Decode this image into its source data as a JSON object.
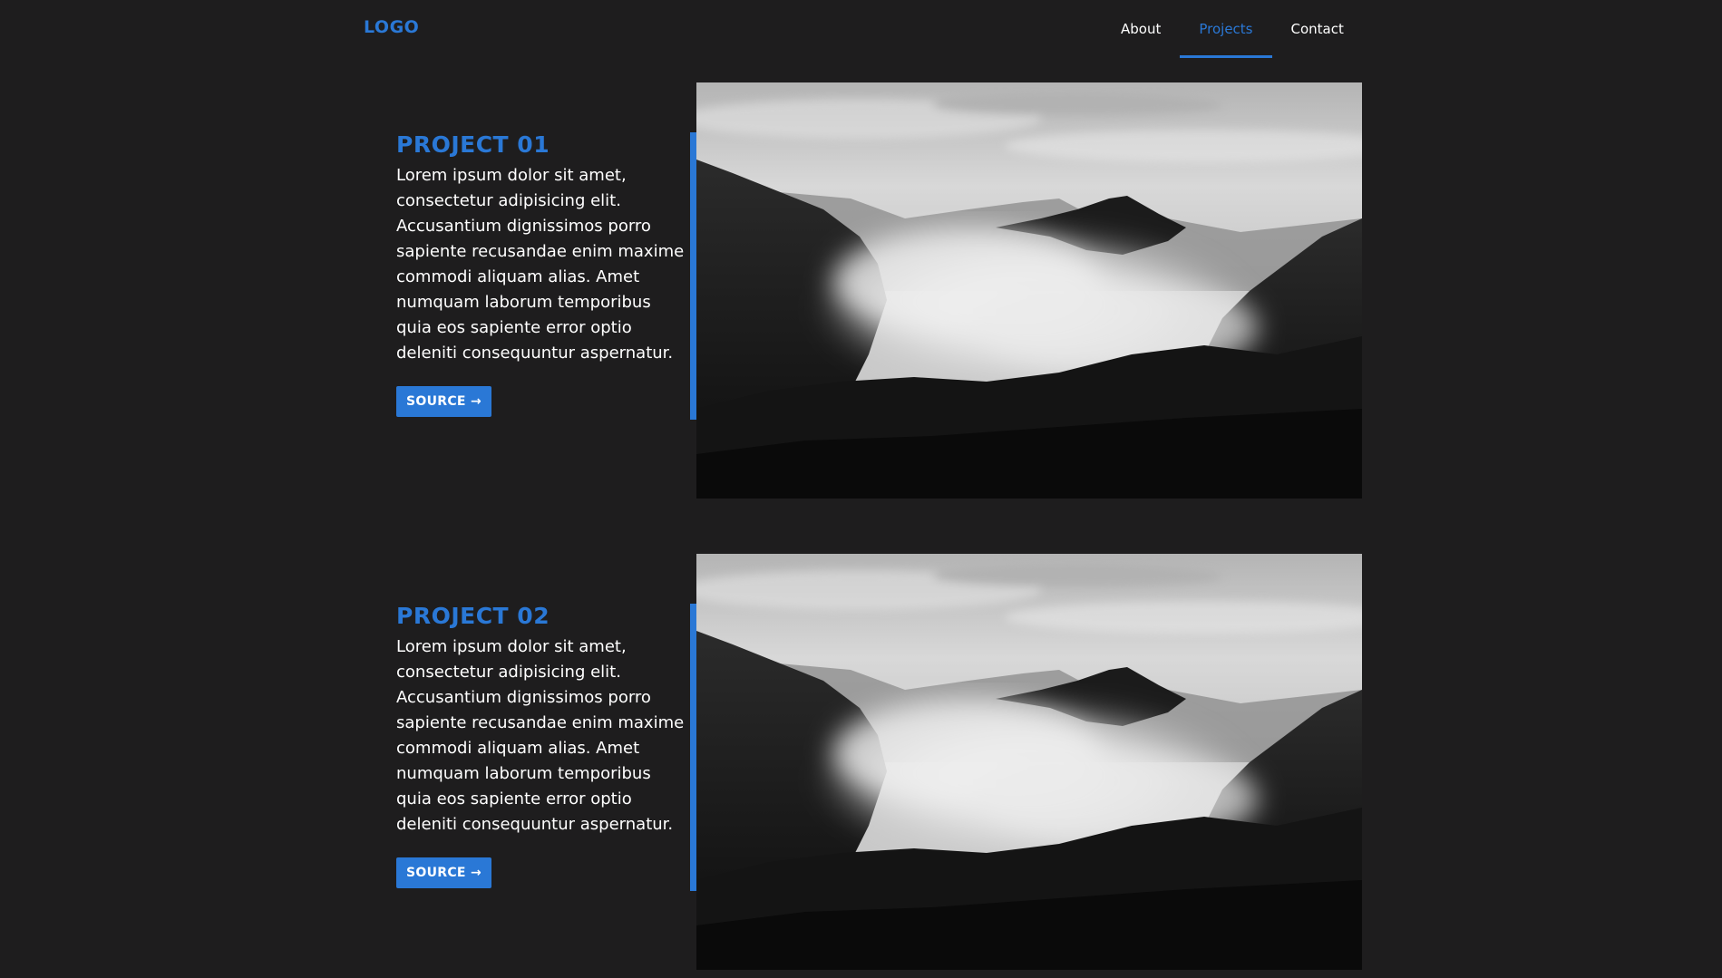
{
  "header": {
    "logo": "LOGO",
    "nav": [
      {
        "label": "About",
        "active": false
      },
      {
        "label": "Projects",
        "active": true
      },
      {
        "label": "Contact",
        "active": false
      }
    ]
  },
  "projects": [
    {
      "title": "PROJECT 01",
      "description": "Lorem ipsum dolor sit amet, consectetur adipisicing elit. Accusantium dignissimos porro sapiente recusandae enim maxime commodi aliquam alias. Amet numquam laborum temporibus quia eos sapiente error optio deleniti consequuntur aspernatur.",
      "button_label": "SOURCE →",
      "image": "misty-mountain-valley-photo"
    },
    {
      "title": "PROJECT 02",
      "description": "Lorem ipsum dolor sit amet, consectetur adipisicing elit. Accusantium dignissimos porro sapiente recusandae enim maxime commodi aliquam alias. Amet numquam laborum temporibus quia eos sapiente error optio deleniti consequuntur aspernatur.",
      "button_label": "SOURCE →",
      "image": "misty-mountain-valley-photo"
    }
  ],
  "colors": {
    "background": "#1e1d1e",
    "accent": "#2a78d6",
    "text": "#ffffff"
  }
}
